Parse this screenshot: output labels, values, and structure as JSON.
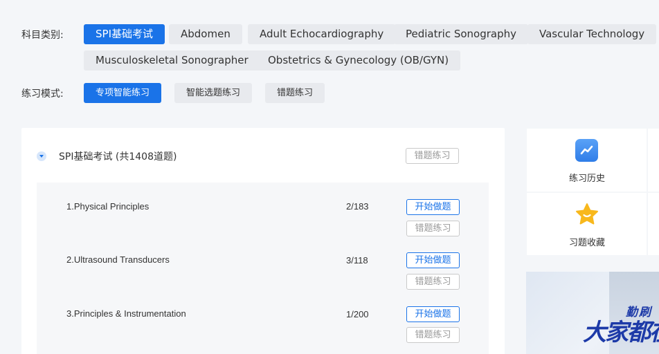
{
  "subject": {
    "label": "科目类别:",
    "options": [
      "SPI基础考试",
      "Abdomen",
      "Adult Echocardiography",
      "Pediatric Sonography",
      "Vascular Technology",
      "Musculoskeletal Sonographer",
      "Obstetrics & Gynecology (OB/GYN)"
    ],
    "selected": "SPI基础考试"
  },
  "mode": {
    "label": "练习模式:",
    "options": [
      "专项智能练习",
      "智能选题练习",
      "错题练习"
    ],
    "selected": "专项智能练习"
  },
  "section": {
    "title": "SPI基础考试 (共1408道题)",
    "wrong_btn": "错题练习",
    "items": [
      {
        "title": "1.Physical Principles",
        "count": "2/183",
        "start": "开始做题",
        "wrong": "错题练习"
      },
      {
        "title": "2.Ultrasound Transducers",
        "count": "3/118",
        "start": "开始做题",
        "wrong": "错题练习"
      },
      {
        "title": "3.Principles & Instrumentation",
        "count": "1/200",
        "start": "开始做题",
        "wrong": "错题练习"
      }
    ]
  },
  "side": {
    "history": "练习历史",
    "favorites": "习题收藏"
  },
  "banner": {
    "line1": "勤刷",
    "line2": "大家都在"
  },
  "colors": {
    "accent": "#1a73e8"
  }
}
